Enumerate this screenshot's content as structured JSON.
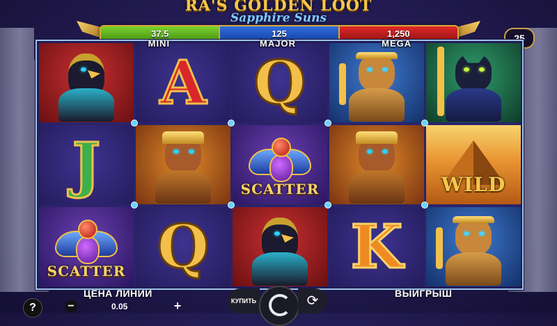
{
  "game": {
    "title": "RA'S GOLDEN LOOT",
    "subtitle": "Sapphire Suns"
  },
  "jackpots": [
    {
      "value": "37.5",
      "label": "MINI",
      "color": "#5cb21e"
    },
    {
      "value": "125",
      "label": "MAJOR",
      "color": "#2054c0"
    },
    {
      "value": "1,250",
      "label": "MEGA",
      "color": "#c01818"
    }
  ],
  "lines": "25",
  "reels": {
    "row1": [
      "falcon-god",
      "letter-A",
      "letter-Q",
      "lioness-goddess",
      "panther-goddess"
    ],
    "row2": [
      "letter-J",
      "bull-god",
      "scatter",
      "bull-god",
      "wild-pyramid"
    ],
    "row3": [
      "scatter",
      "letter-Q",
      "falcon-god",
      "letter-K",
      "lioness-goddess"
    ],
    "letters": {
      "A": "A",
      "Q": "Q",
      "J": "J",
      "K": "K"
    },
    "scatter_text": "SCATTER",
    "wild_text": "WILD"
  },
  "controls": {
    "help": "?",
    "line_price_label": "ЦЕНА ЛИНИИ",
    "line_price_value": "0.05",
    "minus": "−",
    "plus": "+",
    "buy_label": "КУПИТЬ",
    "win_label": "ВЫИГРЫШ"
  }
}
